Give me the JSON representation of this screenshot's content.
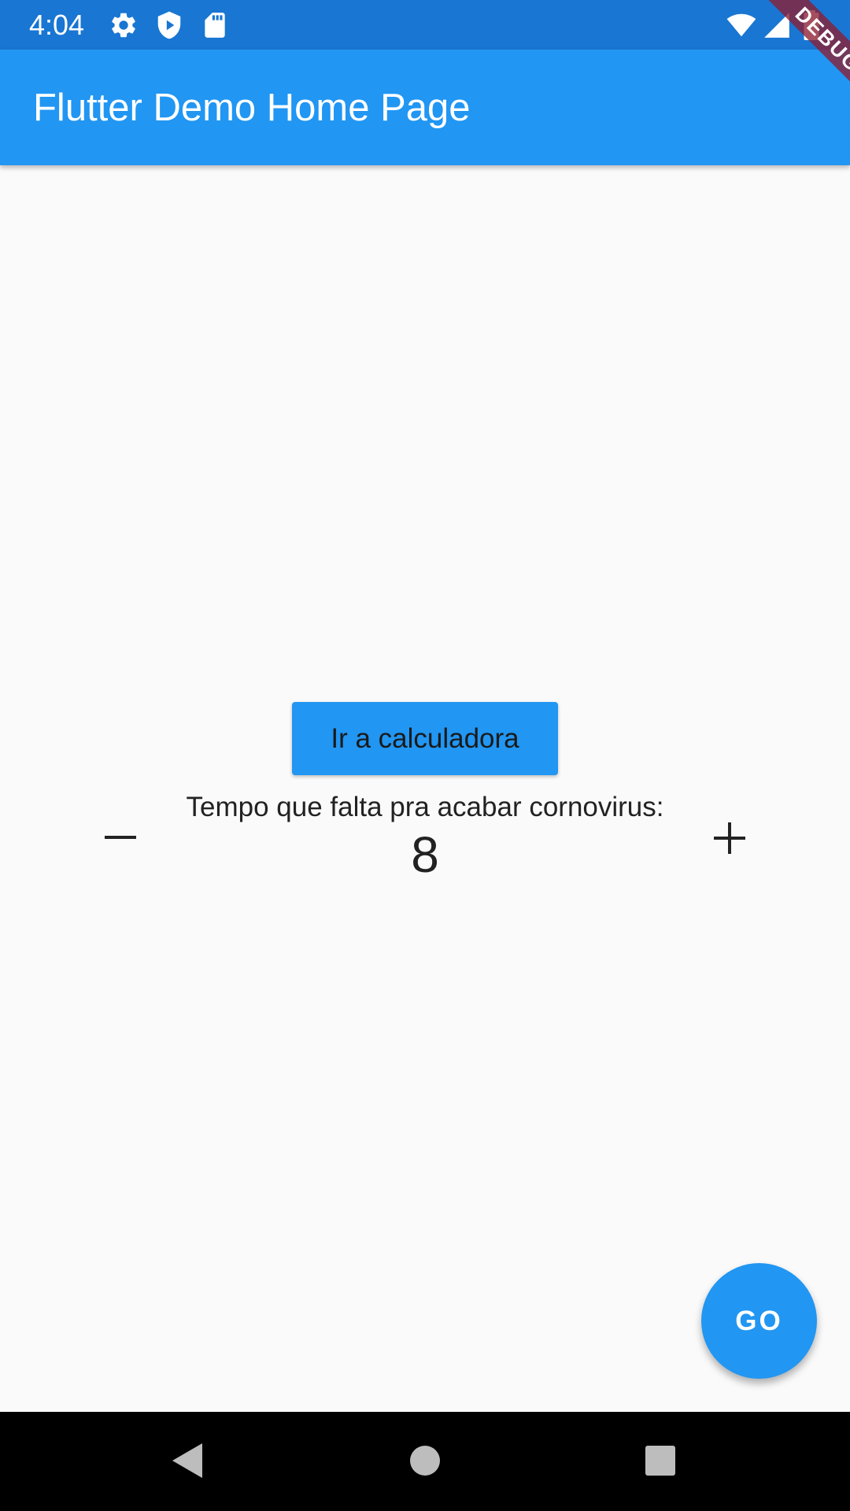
{
  "status_bar": {
    "time": "4:04",
    "left_icons": [
      "settings-icon",
      "play-protect-icon",
      "sd-card-icon"
    ],
    "right_icons": [
      "wifi-icon",
      "cell-signal-icon",
      "battery-icon"
    ]
  },
  "app_bar": {
    "title": "Flutter Demo Home Page",
    "debug_banner": "DEBUG"
  },
  "main": {
    "calculator_button_label": "Ir a calculadora",
    "counter_label": "Tempo que falta pra acabar cornovirus:",
    "counter_value": "8",
    "decrement_icon": "minus-icon",
    "increment_icon": "plus-icon"
  },
  "fab": {
    "label": "GO"
  },
  "nav_bar": {
    "icons": [
      "back-icon",
      "home-icon",
      "recents-icon"
    ]
  },
  "colors": {
    "status_bar": "#1976d2",
    "app_bar": "#2196f3",
    "background": "#fafafa",
    "text": "#222222",
    "debug_ribbon": "#8c1e32",
    "nav_bar": "#000000"
  }
}
